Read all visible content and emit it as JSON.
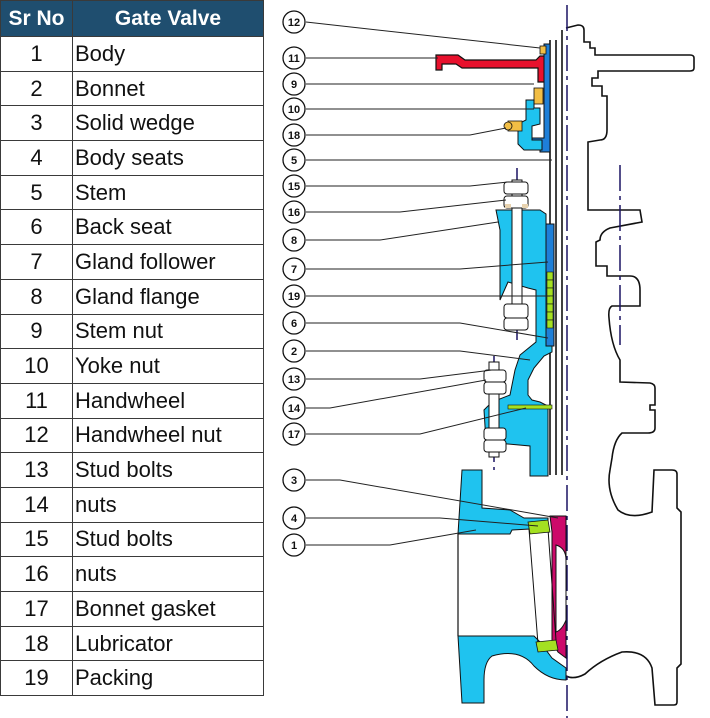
{
  "table": {
    "headers": {
      "sr": "Sr No",
      "name": "Gate Valve"
    },
    "header_color": "#1f4e6f",
    "rows": [
      {
        "sr": "1",
        "name": "Body"
      },
      {
        "sr": "2",
        "name": "Bonnet"
      },
      {
        "sr": "3",
        "name": "Solid wedge"
      },
      {
        "sr": "4",
        "name": "Body seats"
      },
      {
        "sr": "5",
        "name": "Stem"
      },
      {
        "sr": "6",
        "name": "Back seat"
      },
      {
        "sr": "7",
        "name": "Gland follower"
      },
      {
        "sr": "8",
        "name": "Gland flange"
      },
      {
        "sr": "9",
        "name": "Stem nut"
      },
      {
        "sr": "10",
        "name": "Yoke nut"
      },
      {
        "sr": "11",
        "name": "Handwheel"
      },
      {
        "sr": "12",
        "name": "Handwheel nut"
      },
      {
        "sr": "13",
        "name": "Stud bolts"
      },
      {
        "sr": "14",
        "name": "nuts"
      },
      {
        "sr": "15",
        "name": "Stud bolts"
      },
      {
        "sr": "16",
        "name": "nuts"
      },
      {
        "sr": "17",
        "name": "Bonnet gasket"
      },
      {
        "sr": "18",
        "name": "Lubricator"
      },
      {
        "sr": "19",
        "name": "Packing"
      }
    ]
  },
  "diagram": {
    "callouts": [
      "12",
      "11",
      "9",
      "10",
      "18",
      "5",
      "15",
      "16",
      "8",
      "7",
      "19",
      "6",
      "2",
      "13",
      "14",
      "17",
      "3",
      "4",
      "1"
    ],
    "colors": {
      "body": "#1fc3ef",
      "yoke_blue": "#1e7fd8",
      "handwheel": "#e8112d",
      "wedge": "#cc0a6a",
      "seat_packing": "#a4e021",
      "brass": "#f2be45",
      "centerline": "#1b1464"
    }
  }
}
